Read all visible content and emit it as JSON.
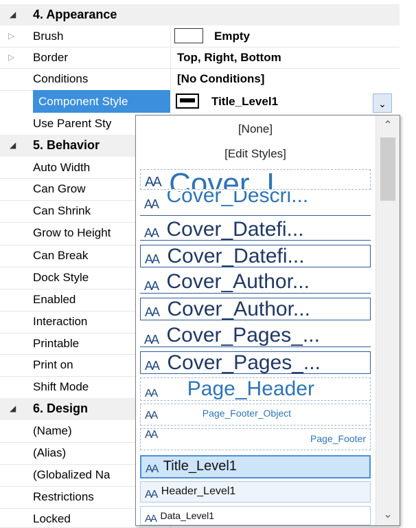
{
  "categories": {
    "appearance": "4. Appearance",
    "behavior": "5. Behavior",
    "design": "6. Design"
  },
  "properties": {
    "brush": {
      "name": "Brush",
      "value": "Empty"
    },
    "border": {
      "name": "Border",
      "value": "Top, Right, Bottom"
    },
    "conditions": {
      "name": "Conditions",
      "value": "[No Conditions]"
    },
    "component_style": {
      "name": "Component Style",
      "value": "Title_Level1"
    },
    "use_parent_styles": {
      "name": "Use Parent Sty"
    },
    "auto_width": {
      "name": "Auto Width"
    },
    "can_grow": {
      "name": "Can Grow"
    },
    "can_shrink": {
      "name": "Can Shrink"
    },
    "grow_to_height": {
      "name": "Grow to Height"
    },
    "can_break": {
      "name": "Can Break"
    },
    "dock_style": {
      "name": "Dock Style"
    },
    "enabled": {
      "name": "Enabled"
    },
    "interaction": {
      "name": "Interaction"
    },
    "printable": {
      "name": "Printable"
    },
    "print_on": {
      "name": "Print on"
    },
    "shift_mode": {
      "name": "Shift Mode"
    },
    "name": {
      "name": "(Name)"
    },
    "alias": {
      "name": "(Alias)"
    },
    "globalized_name": {
      "name": "(Globalized Na"
    },
    "restrictions": {
      "name": "Restrictions"
    },
    "locked": {
      "name": "Locked"
    }
  },
  "dropdown": {
    "none_label": "[None]",
    "edit_styles_label": "[Edit Styles]",
    "aa_glyph": "AA",
    "styles": [
      {
        "label": "Cover_I..."
      },
      {
        "label": "Cover_Descri..."
      },
      {
        "label": "Cover_Datefi..."
      },
      {
        "label": "Cover_Datefi..."
      },
      {
        "label": "Cover_Author..."
      },
      {
        "label": "Cover_Author..."
      },
      {
        "label": "Cover_Pages_..."
      },
      {
        "label": "Cover_Pages_..."
      },
      {
        "label": "Page_Header"
      },
      {
        "label": "Page_Footer_Object"
      },
      {
        "label": "Page_Footer"
      },
      {
        "label": "Title_Level1"
      },
      {
        "label": "Header_Level1"
      },
      {
        "label": "Data_Level1"
      }
    ],
    "selected": "Title_Level1"
  },
  "icons": {
    "collapse": "collapse-triangle-icon",
    "expand": "expand-triangle-icon",
    "dropdown": "chevron-down-icon"
  },
  "colors": {
    "selection": "#3c8fdc",
    "style_text": "#1f3864"
  }
}
